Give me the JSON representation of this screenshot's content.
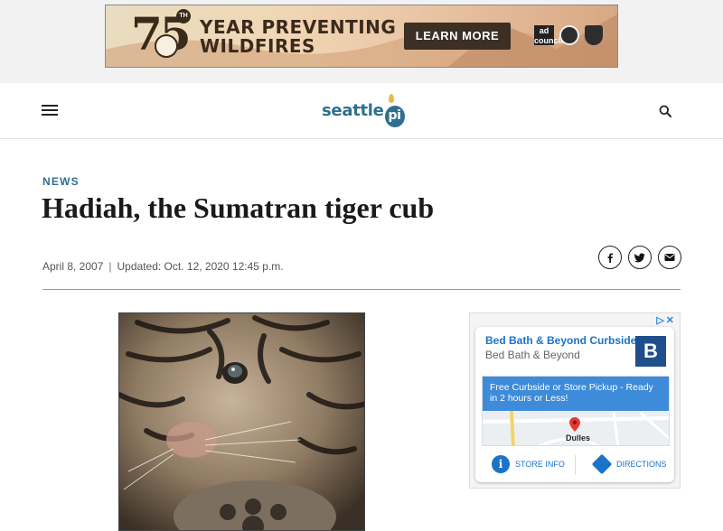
{
  "ad_banner": {
    "anniversary_number": "75",
    "anniversary_suffix": "TH",
    "headline_line1": "YEAR PREVENTING",
    "headline_line2": "WILDFIRES",
    "cta_label": "LEARN MORE",
    "logo_ad_council": "ad council"
  },
  "header": {
    "logo_text": "seattle",
    "logo_pi": "pi"
  },
  "article": {
    "kicker": "NEWS",
    "title": "Hadiah, the Sumatran tiger cub",
    "published": "April 8, 2007",
    "separator": "|",
    "updated": "Updated: Oct. 12, 2020 12:45 p.m."
  },
  "side_ad": {
    "title": "Bed Bath & Beyond Curbside",
    "subtitle": "Bed Bath & Beyond",
    "brand_letter": "B",
    "offer": "Free Curbside or Store Pickup - Ready in 2 hours or Less!",
    "map_location": "Dulles",
    "store_info_label": "STORE INFO",
    "directions_label": "DIRECTIONS",
    "store_info_glyph": "i"
  },
  "colors": {
    "brand": "#2d6f8e",
    "ad_link": "#1a73c8",
    "ad_brand_bg": "#1f4e8c",
    "offer_bg": "#3d8bd9"
  }
}
